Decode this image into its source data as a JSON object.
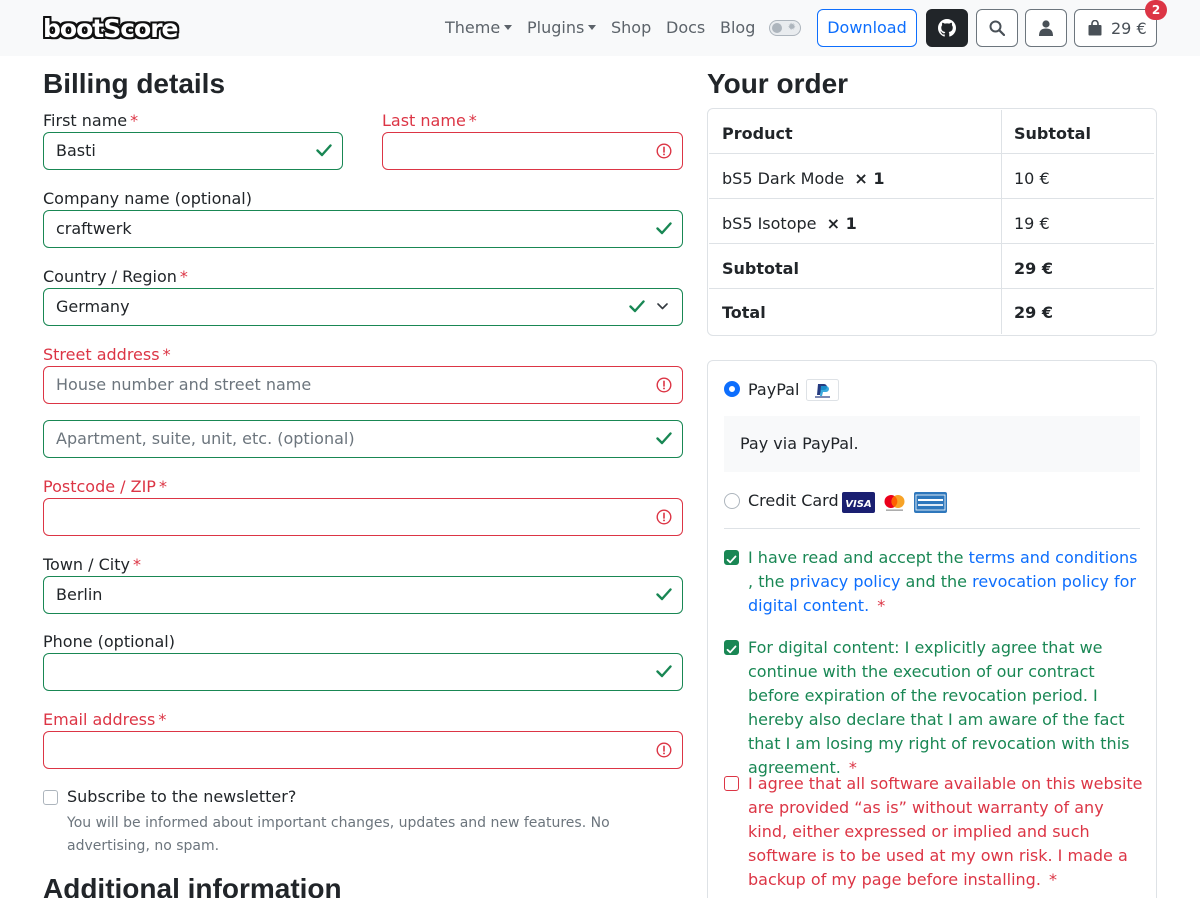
{
  "navbar": {
    "logo": "bootScore",
    "links": [
      {
        "label": "Theme",
        "dropdown": true
      },
      {
        "label": "Plugins",
        "dropdown": true
      },
      {
        "label": "Shop",
        "dropdown": false
      },
      {
        "label": "Docs",
        "dropdown": false
      },
      {
        "label": "Blog",
        "dropdown": false
      }
    ],
    "download_label": "Download",
    "cart_total": "29 €",
    "cart_count": "2"
  },
  "billing": {
    "title": "Billing details",
    "first_name": {
      "label": "First name",
      "value": "Basti",
      "state": "valid"
    },
    "last_name": {
      "label": "Last name",
      "value": "",
      "state": "invalid"
    },
    "company": {
      "label": "Company name (optional)",
      "value": "craftwerk",
      "state": "valid"
    },
    "country": {
      "label": "Country / Region",
      "value": "Germany",
      "state": "valid"
    },
    "street": {
      "label": "Street address",
      "placeholder": "House number and street name",
      "state": "invalid"
    },
    "street2": {
      "placeholder": "Apartment, suite, unit, etc. (optional)",
      "state": "valid"
    },
    "postcode": {
      "label": "Postcode / ZIP",
      "value": "",
      "state": "invalid"
    },
    "city": {
      "label": "Town / City",
      "value": "Berlin",
      "state": "valid"
    },
    "phone": {
      "label": "Phone (optional)",
      "value": "",
      "state": "valid"
    },
    "email": {
      "label": "Email address",
      "value": "",
      "state": "invalid"
    },
    "required_mark": "*",
    "newsletter_label": "Subscribe to the newsletter?",
    "newsletter_help": "You will be informed about important changes, updates and new features. No advertising, no spam."
  },
  "additional": {
    "title": "Additional information"
  },
  "order": {
    "title": "Your order",
    "col_product": "Product",
    "col_subtotal": "Subtotal",
    "items": [
      {
        "name": "bS5 Dark Mode",
        "qty": "× 1",
        "price": "10 €"
      },
      {
        "name": "bS5 Isotope",
        "qty": "× 1",
        "price": "19 €"
      }
    ],
    "subtotal_label": "Subtotal",
    "subtotal_value": "29 €",
    "total_label": "Total",
    "total_value": "29 €"
  },
  "payment": {
    "paypal_label": "PayPal",
    "paypal_desc": "Pay via PayPal.",
    "card_label": "Credit Card",
    "consent1": {
      "pre": "I have read and accept the",
      "terms": "terms and conditions",
      "comma": ",",
      "the1": "the",
      "privacy": "privacy policy",
      "and_the": "and the",
      "revocation": "revocation policy for digital content.",
      "req": "*"
    },
    "consent2": "For digital content: I explicitly agree that we continue with the execution of our contract before expiration of the revocation period. I hereby also declare that I am aware of the fact that I am losing my right of revocation with this agreement.",
    "consent3": "I agree that all software available on this website are provided “as is” without warranty of any kind, either expressed or implied and such software is to be used at my own risk. I made a backup of my page before installing."
  },
  "colors": {
    "valid": "#198754",
    "invalid": "#dc3545",
    "primary": "#0d6efd"
  }
}
